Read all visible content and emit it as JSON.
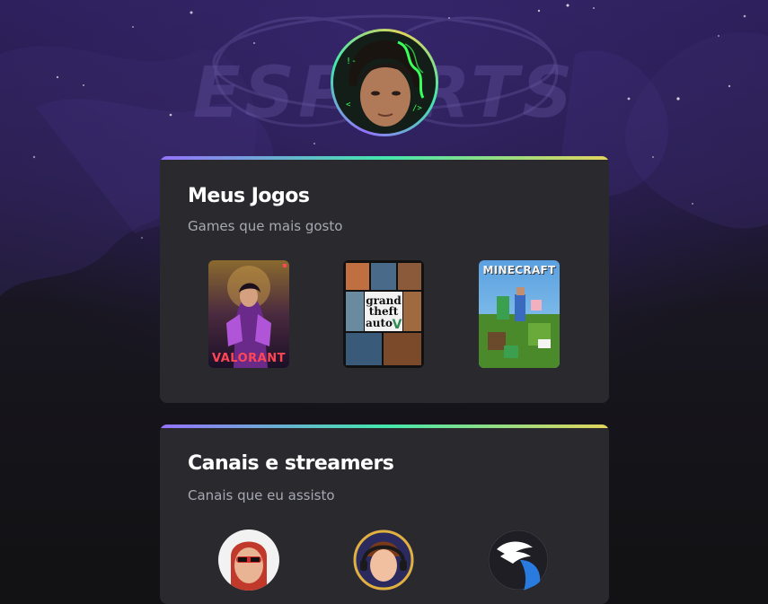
{
  "profile": {
    "avatar_icon": "profile-avatar-photo"
  },
  "background": {
    "watermark_text": "ESPORTS",
    "colors": {
      "top": "#2d1f5a",
      "bottom": "#121214"
    }
  },
  "theme": {
    "card_bg": "#29292e",
    "gradient": [
      "#9572fc",
      "#43e7ad",
      "#e2d45c"
    ],
    "title_color": "#ffffff",
    "subtitle_color": "#a8a8b3"
  },
  "games_section": {
    "title": "Meus Jogos",
    "subtitle": "Games que mais gosto",
    "games": [
      {
        "name": "Valorant",
        "cover_text": "VALORANT",
        "icon": "valorant-cover"
      },
      {
        "name": "Grand Theft Auto V",
        "cover_text": [
          "grand",
          "theft",
          "auto",
          "V"
        ],
        "icon": "gta-v-cover"
      },
      {
        "name": "Minecraft",
        "cover_text": "MINECRAFT",
        "icon": "minecraft-cover"
      }
    ]
  },
  "channels_section": {
    "title": "Canais e streamers",
    "subtitle": "Canais que eu assisto",
    "channels": [
      {
        "icon": "streamer-avatar-red-glasses"
      },
      {
        "icon": "streamer-avatar-cartoon-headset"
      },
      {
        "icon": "streamer-avatar-winged-logo"
      }
    ]
  }
}
